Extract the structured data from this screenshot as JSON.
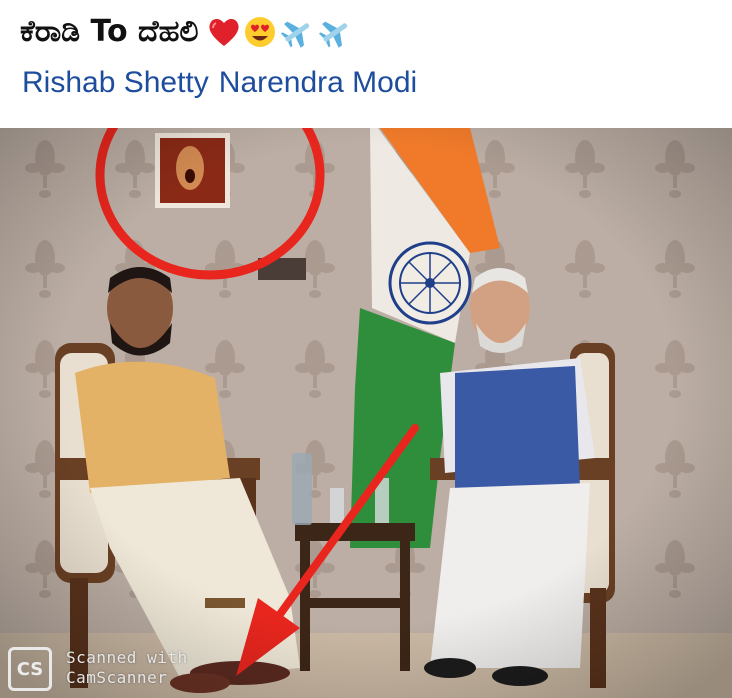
{
  "post": {
    "caption_text": "ಕೆರಾಡಿ To ದೆಹಲಿ",
    "tags": [
      "Rishab Shetty",
      "Narendra Modi"
    ]
  },
  "watermark": {
    "badge": "CS",
    "line1": "Scanned with",
    "line2": "CamScanner"
  },
  "icons": [
    "heart-icon",
    "heart-eyes-icon",
    "airplane-icon",
    "airplane-icon"
  ],
  "colors": {
    "tag_link": "#1d4d9c",
    "annotation_red": "#e8261e"
  }
}
